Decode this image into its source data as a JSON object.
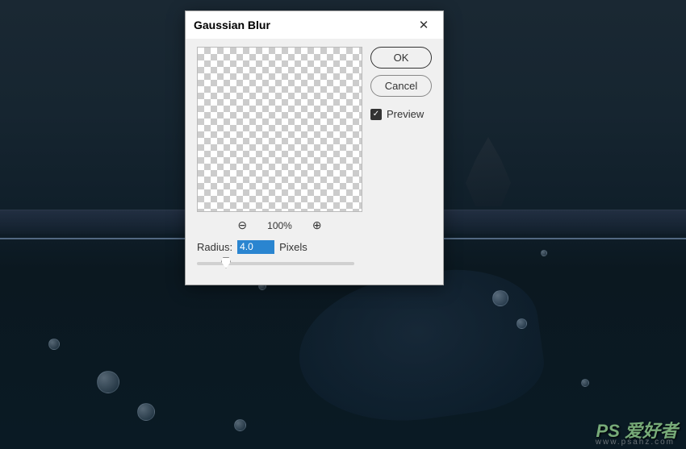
{
  "background": {
    "watermark_main": "PS 爱好者",
    "watermark_url": "www.psahz.com"
  },
  "dialog": {
    "title": "Gaussian Blur",
    "close_label": "✕",
    "ok_label": "OK",
    "cancel_label": "Cancel",
    "preview_label": "Preview",
    "preview_checked": true,
    "zoom_out_glyph": "⊖",
    "zoom_in_glyph": "⊕",
    "zoom_level": "100%",
    "radius_label": "Radius:",
    "radius_value": "4.0",
    "radius_units": "Pixels"
  }
}
